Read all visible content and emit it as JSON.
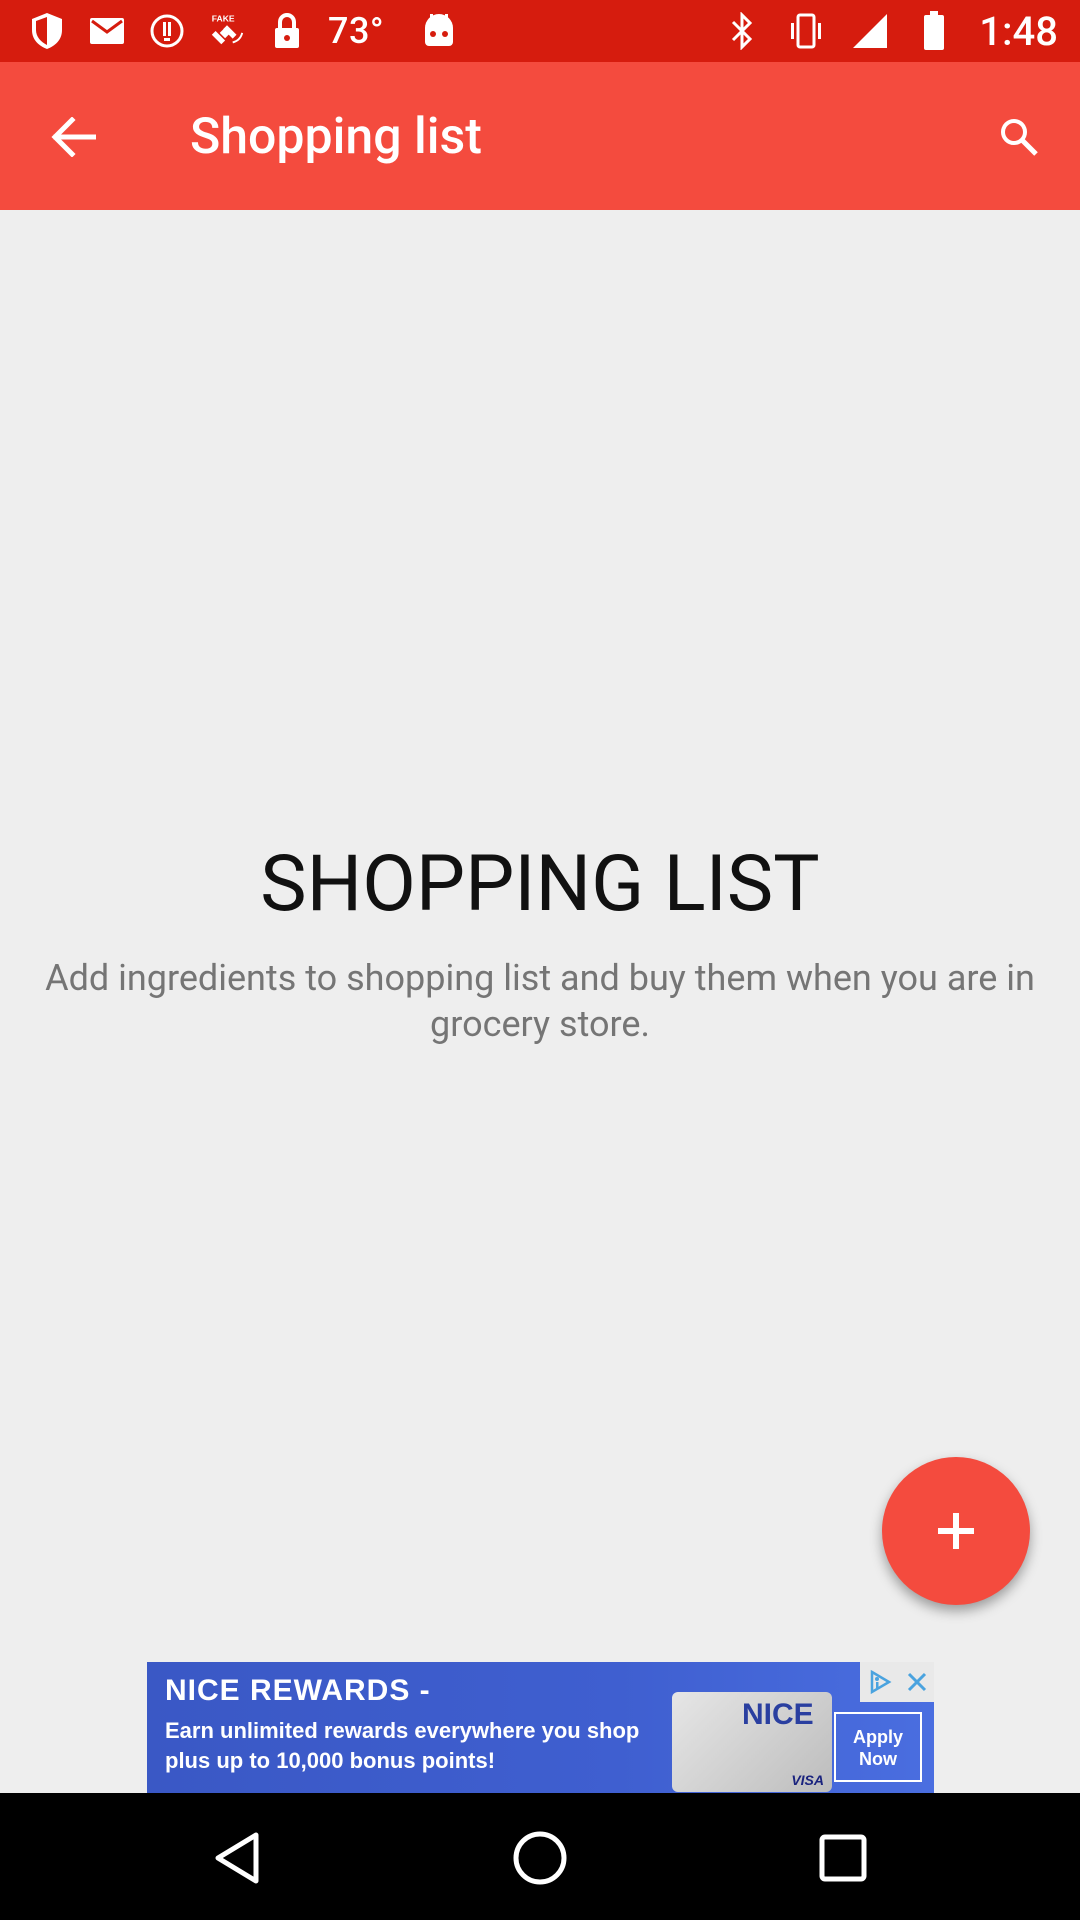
{
  "colors": {
    "status_bar": "#d61c0e",
    "app_bar": "#f44b3e",
    "accent": "#f44b3e",
    "background": "#eeeeee",
    "ad_background": "#3f5fd0"
  },
  "status_bar": {
    "icons_left": [
      "shield-icon",
      "gmail-icon",
      "alert-icon",
      "fake-gps-icon",
      "lock-icon"
    ],
    "temperature": "73°",
    "icons_right": [
      "android-icon",
      "bluetooth-icon",
      "vibrate-icon",
      "signal-icon",
      "battery-icon"
    ],
    "time": "1:48"
  },
  "app_bar": {
    "title": "Shopping list",
    "back_icon": "back-arrow-icon",
    "search_icon": "search-icon"
  },
  "empty_state": {
    "heading": "SHOPPING LIST",
    "description": "Add ingredients to shopping list and buy them when you are in grocery store."
  },
  "fab": {
    "icon": "plus-icon"
  },
  "ad": {
    "title": "NICE REWARDS -",
    "body": "Earn unlimited rewards everywhere you shop plus up to 10,000 bonus points!",
    "card_label": "NICE",
    "card_brand": "VISA",
    "cta": "Apply Now"
  },
  "nav_bar": {
    "buttons": [
      "back-triangle-icon",
      "home-circle-icon",
      "recents-square-icon"
    ]
  }
}
